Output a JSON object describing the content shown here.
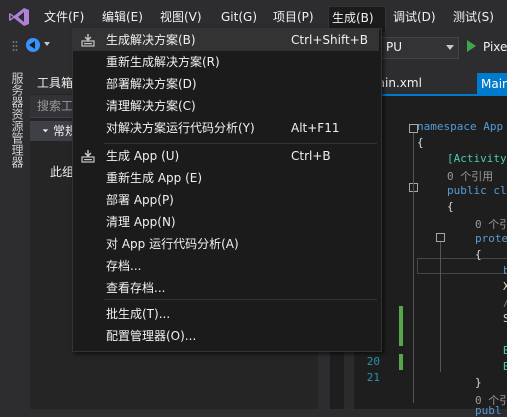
{
  "menubar": {
    "items": [
      {
        "label": "文件(F)"
      },
      {
        "label": "编辑(E)"
      },
      {
        "label": "视图(V)"
      },
      {
        "label": "Git(G)"
      },
      {
        "label": "项目(P)"
      },
      {
        "label": "生成(B)"
      },
      {
        "label": "调试(D)"
      },
      {
        "label": "测试(S)"
      }
    ]
  },
  "toolbar": {
    "platform_value": "PU",
    "run_label": "Pixe"
  },
  "side_tab": "服务器资源管理器",
  "toolbox": {
    "title": "工具箱",
    "search_placeholder": "搜索工",
    "group_label": "常规",
    "empty_text": "此组"
  },
  "editor": {
    "tab_file": "main.xml",
    "tab_active": "Main",
    "line_numbers": [
      "20",
      "21"
    ],
    "lines": [
      {
        "text": "namespace App",
        "color": "#569cd6"
      },
      {
        "text": "{",
        "color": "#dcdcdc"
      },
      {
        "text": "[Activity",
        "color": "#4ec9b0"
      },
      {
        "text": "0 个引用",
        "color": "#999999"
      },
      {
        "text": "public cl",
        "color": "#569cd6"
      },
      {
        "text": "{",
        "color": "#dcdcdc"
      },
      {
        "text": "0 个引",
        "color": "#999999"
      },
      {
        "text": "prote",
        "color": "#569cd6"
      },
      {
        "text": "{",
        "color": "#dcdcdc"
      },
      {
        "text": "b",
        "color": "#569cd6"
      },
      {
        "text": "X",
        "color": "#dcdcdc"
      },
      {
        "text": "/",
        "color": "#57a64a"
      },
      {
        "text": "S",
        "color": "#dcdcdc"
      },
      {
        "text": "B",
        "color": "#4ec9b0"
      },
      {
        "text": "B",
        "color": "#4ec9b0"
      },
      {
        "text": "}",
        "color": "#dcdcdc"
      },
      {
        "text": "0 个引",
        "color": "#999999"
      },
      {
        "text": "publ",
        "color": "#569cd6"
      }
    ]
  },
  "build_menu": {
    "items": [
      {
        "label": "生成解决方案(B)",
        "shortcut": "Ctrl+Shift+B",
        "icon": "build-solution-icon"
      },
      {
        "label": "重新生成解决方案(R)",
        "shortcut": ""
      },
      {
        "label": "部署解决方案(D)",
        "shortcut": ""
      },
      {
        "label": "清理解决方案(C)",
        "shortcut": ""
      },
      {
        "label": "对解决方案运行代码分析(Y)",
        "shortcut": "Alt+F11"
      },
      {
        "label": "生成 App (U)",
        "shortcut": "Ctrl+B",
        "icon": "build-project-icon"
      },
      {
        "label": "重新生成 App (E)",
        "shortcut": ""
      },
      {
        "label": "部署 App(P)",
        "shortcut": ""
      },
      {
        "label": "清理 App(N)",
        "shortcut": ""
      },
      {
        "label": "对 App 运行代码分析(A)",
        "shortcut": ""
      },
      {
        "label": "存档...",
        "shortcut": ""
      },
      {
        "label": "查看存档...",
        "shortcut": ""
      },
      {
        "label": "批生成(T)...",
        "shortcut": ""
      },
      {
        "label": "配置管理器(O)...",
        "shortcut": ""
      }
    ]
  },
  "colors": {
    "accent": "#007acc",
    "menu_bg": "#1b1b1c",
    "highlight": "#333334",
    "run_green": "#3ea64b"
  }
}
